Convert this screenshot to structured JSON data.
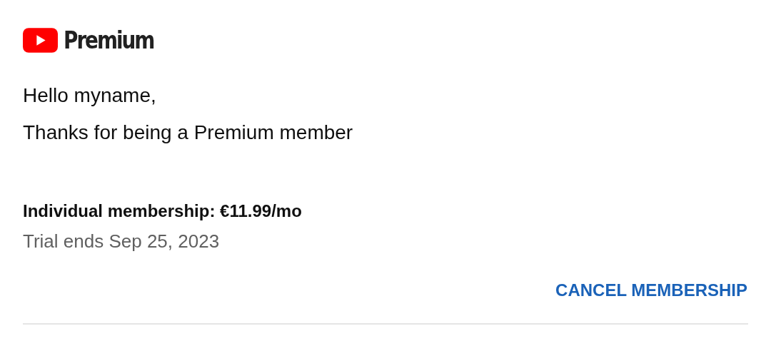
{
  "logo": {
    "wordmark": "Premium"
  },
  "greeting": [
    "Hello myname,",
    "Thanks for being a Premium member"
  ],
  "membership": {
    "plan": "Individual membership: €11.99/mo",
    "trial": "Trial ends Sep 25, 2023"
  },
  "actions": [
    "CANCEL MEMBERSHIP"
  ]
}
